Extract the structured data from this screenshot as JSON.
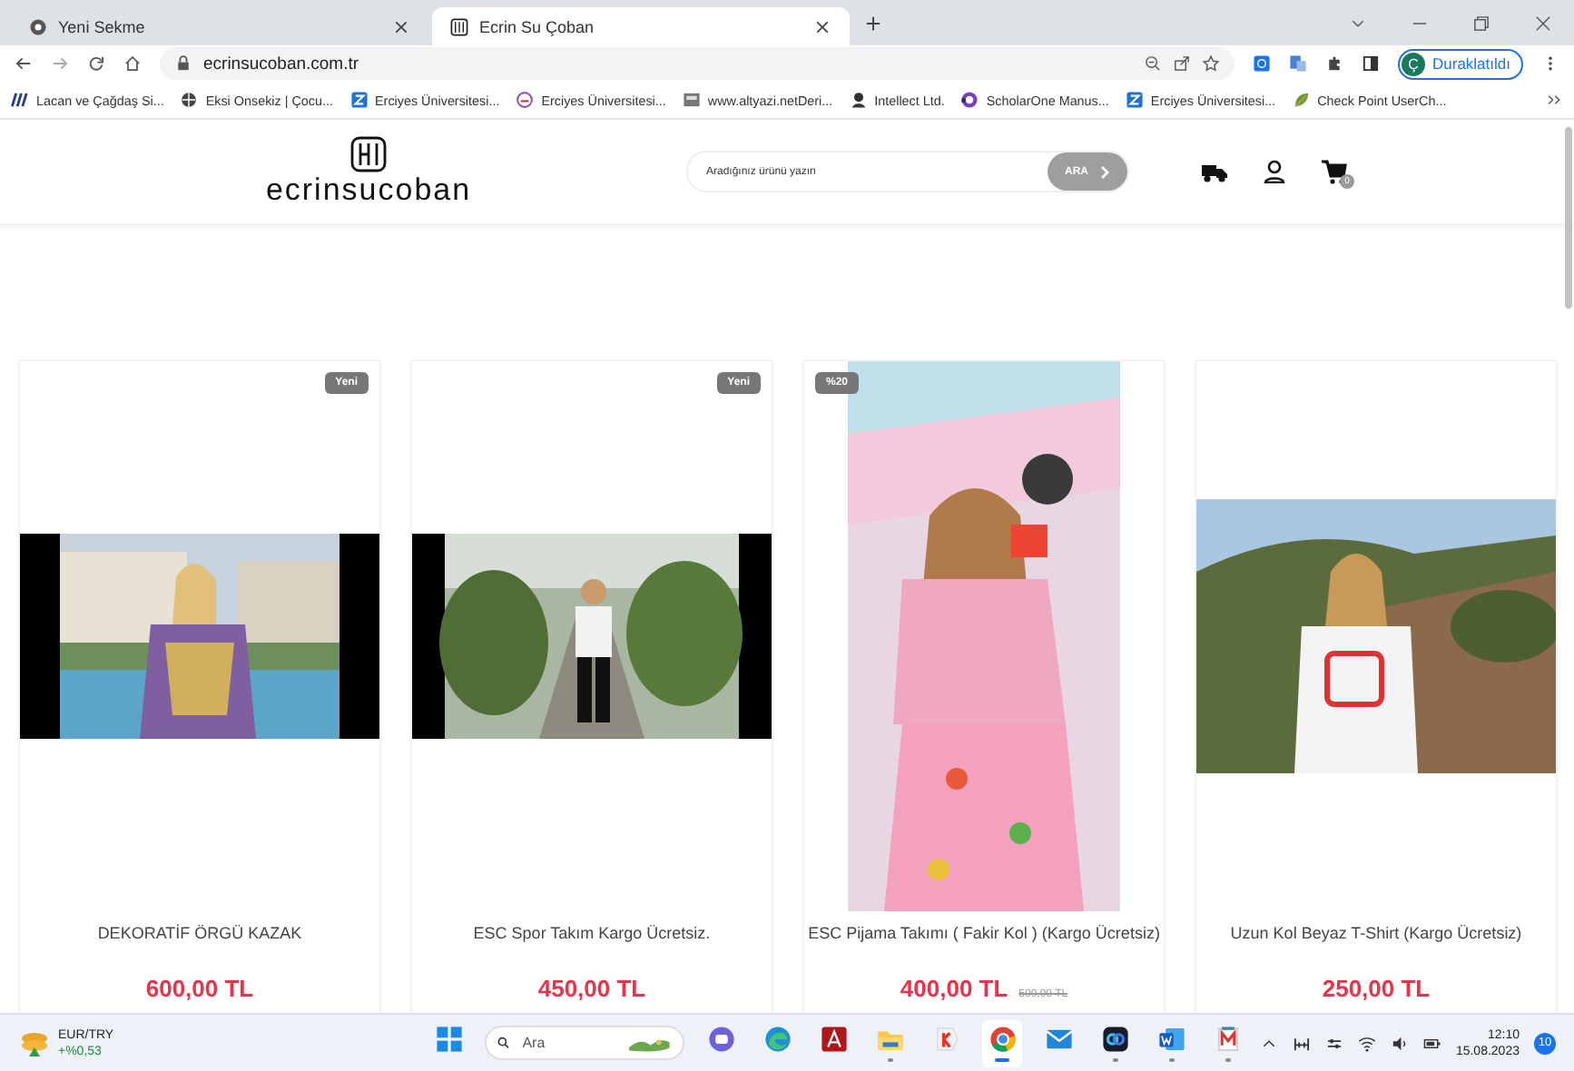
{
  "browser": {
    "tabs": [
      {
        "title": "Yeni Sekme",
        "selected": false
      },
      {
        "title": "Ecrin Su Çoban",
        "selected": true
      }
    ],
    "url": "ecrinsucoban.com.tr",
    "profile": {
      "initial": "Ç",
      "status": "Duraklatıldı"
    },
    "bookmarks": [
      {
        "label": "Lacan ve Çağdaş Si...",
        "kind": "lines"
      },
      {
        "label": "Eksi Onsekiz | Çocu...",
        "kind": "globe"
      },
      {
        "label": "Erciyes Üniversitesi...",
        "kind": "square"
      },
      {
        "label": "Erciyes Üniversitesi...",
        "kind": "seal"
      },
      {
        "label": "www.altyazi.netDeri...",
        "kind": "box"
      },
      {
        "label": "Intellect Ltd.",
        "kind": "person"
      },
      {
        "label": "ScholarOne Manus...",
        "kind": "ring"
      },
      {
        "label": "Erciyes Üniversitesi...",
        "kind": "square"
      },
      {
        "label": "Check Point UserCh...",
        "kind": "leaf"
      }
    ]
  },
  "site": {
    "logo": "ecrinsucoban",
    "search": {
      "placeholder": "Aradığınız ürünü yazın",
      "button": "ARA"
    },
    "cart_count": "0"
  },
  "products": [
    {
      "name": "DEKORATİF ÖRGÜ KAZAK",
      "price": "600,00 TL",
      "badge": {
        "text": "Yeni",
        "kind": "new"
      }
    },
    {
      "name": "ESC Spor Takım Kargo Ücretsiz.",
      "price": "450,00 TL",
      "badge": {
        "text": "Yeni",
        "kind": "new"
      }
    },
    {
      "name": "ESC Pijama Takımı ( Fakir Kol ) (Kargo Ücretsiz)",
      "price": "400,00 TL",
      "old_price": "500,00 TL",
      "badge": {
        "text": "%20",
        "kind": "discount"
      }
    },
    {
      "name": "Uzun Kol Beyaz T-Shirt (Kargo Ücretsiz)",
      "price": "250,00 TL"
    }
  ],
  "taskbar": {
    "widget": {
      "title": "EUR/TRY",
      "change": "+%0,53"
    },
    "search_placeholder": "Ara",
    "apps": [
      {
        "kind": "windows",
        "running": false,
        "selected": false
      },
      {
        "kind": "chat",
        "running": false,
        "selected": false
      },
      {
        "kind": "edge",
        "running": false,
        "selected": false
      },
      {
        "kind": "pdf",
        "running": false,
        "selected": false
      },
      {
        "kind": "folder",
        "running": true,
        "selected": false
      },
      {
        "kind": "yandex",
        "running": false,
        "selected": false
      },
      {
        "kind": "chrome",
        "running": true,
        "selected": true
      },
      {
        "kind": "mail",
        "running": false,
        "selected": false
      },
      {
        "kind": "webex",
        "running": true,
        "selected": false
      },
      {
        "kind": "word",
        "running": true,
        "selected": false
      },
      {
        "kind": "mendeley",
        "running": true,
        "selected": false
      }
    ],
    "time": "12:10",
    "date": "15.08.2023",
    "notifications": "10"
  }
}
